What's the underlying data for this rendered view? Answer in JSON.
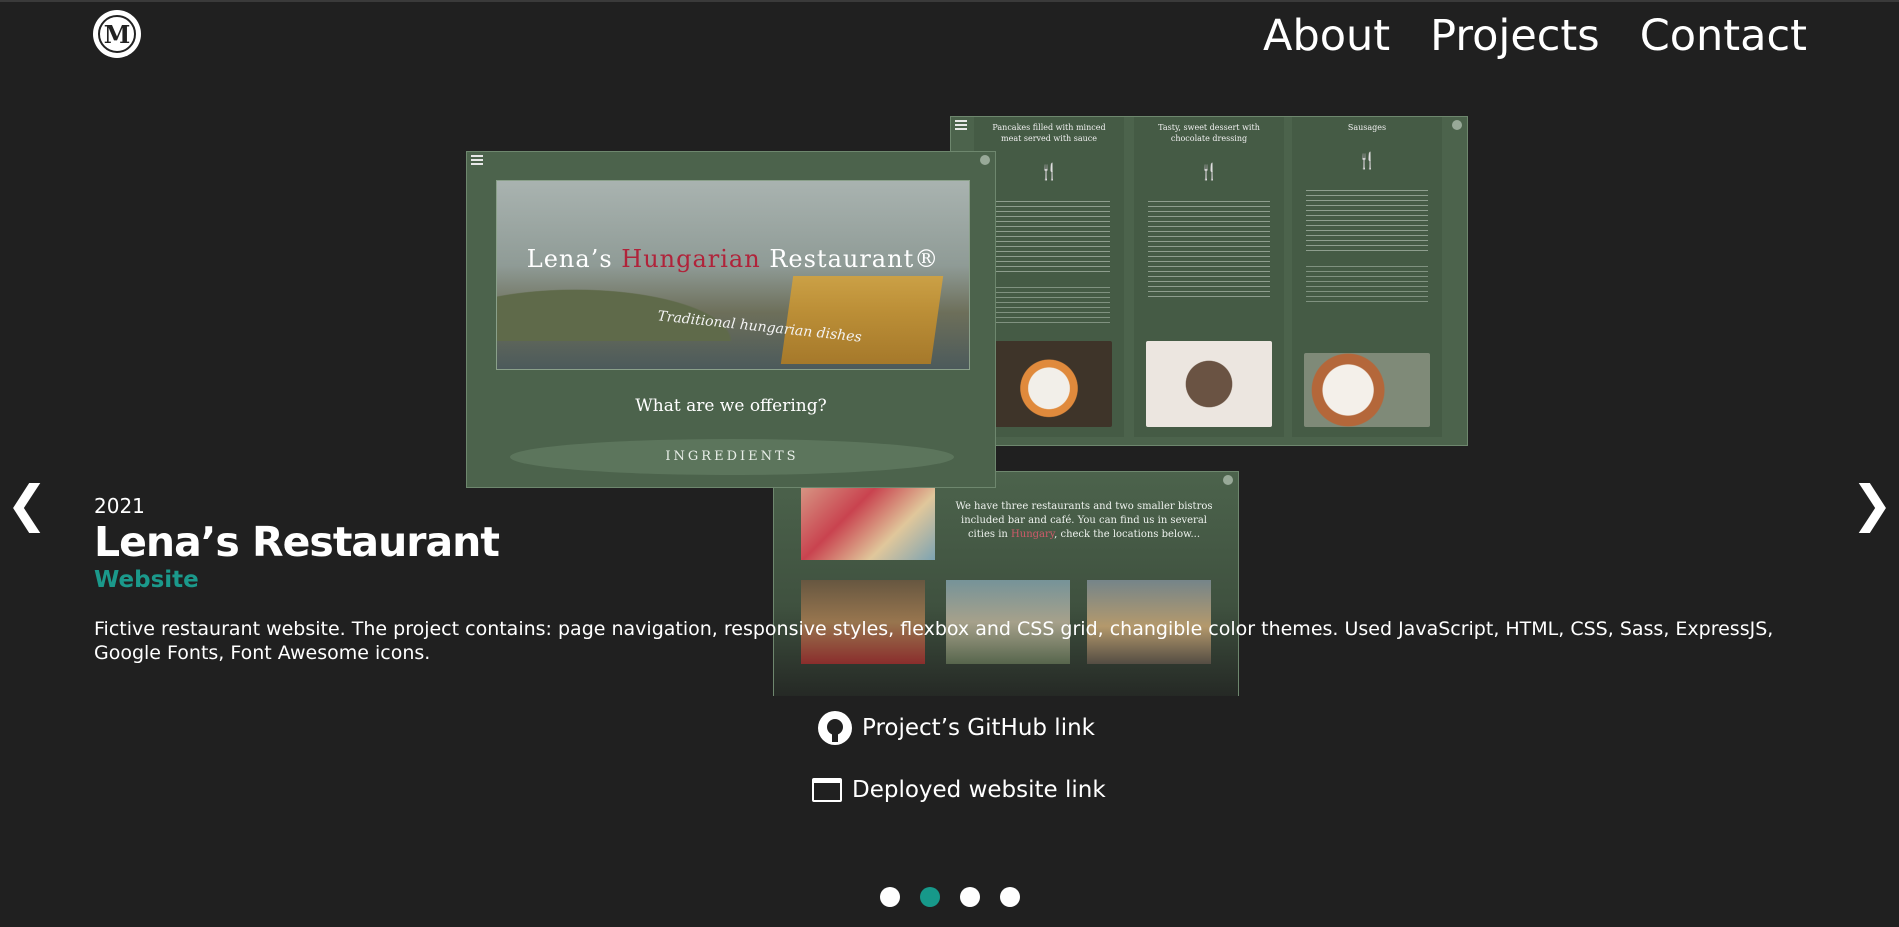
{
  "colors": {
    "background": "#202020",
    "accent": "#1b998b",
    "text": "#ffffff",
    "mock_green": "#4c634c",
    "mock_red": "#b0233a"
  },
  "header": {
    "logo_letter": "M",
    "nav": [
      "About",
      "Projects",
      "Contact"
    ]
  },
  "preview": {
    "hero_title_a": "Lena’s ",
    "hero_title_b": "Hungarian",
    "hero_title_c": " Restaurant",
    "hero_registered": "®",
    "hero_subtitle": "Traditional hungarian dishes",
    "offer_heading": "What are we offering?",
    "ingredients_button": "INGREDIENTS",
    "dish_columns": [
      {
        "title": "Pancakes filled with minced meat served with sauce"
      },
      {
        "title": "Tasty, sweet dessert with chocolate dressing"
      },
      {
        "title": "Sausages"
      }
    ],
    "info_text_a": "We have three restaurants and two smaller bistros included bar and café. You can find us in several cities in",
    "info_text_red": "Hungary",
    "info_text_b": ", check the locations below..."
  },
  "project": {
    "year": "2021",
    "title": "Lena’s Restaurant",
    "type": "Website",
    "description": "Fictive restaurant website. The project contains: page navigation, responsive styles, flexbox and CSS grid, changible color themes. Used JavaScript, HTML, CSS, Sass, ExpressJS, Google Fonts, Font Awesome icons.",
    "github_link": "Project’s GitHub link",
    "deployed_link": "Deployed website link"
  },
  "carousel": {
    "prev": "❮",
    "next": "❯",
    "slide_count": 4,
    "active_index": 1
  }
}
